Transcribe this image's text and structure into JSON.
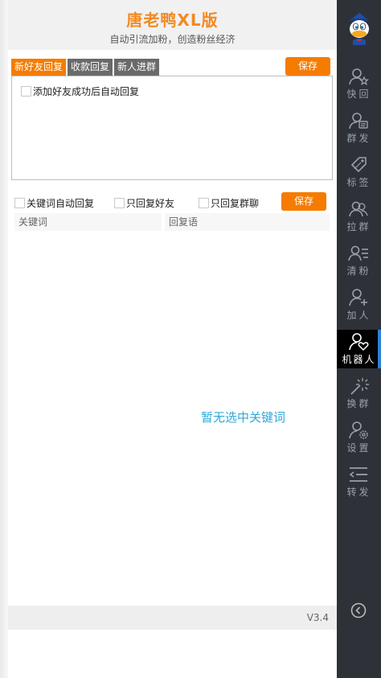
{
  "header": {
    "title": "唐老鸭XL版",
    "subtitle": "自动引流加粉，创造粉丝经济"
  },
  "tabs": [
    {
      "label": "新好友回复",
      "active": true
    },
    {
      "label": "收款回复",
      "active": false
    },
    {
      "label": "新人进群",
      "active": false
    }
  ],
  "save_top_label": "保存",
  "reply_box": {
    "checkbox_label": "添加好友成功后自动回复",
    "checked": false
  },
  "options": {
    "keyword_auto_reply": "关键词自动回复",
    "reply_friends_only": "只回复好友",
    "reply_groups_only": "只回复群聊",
    "save_label": "保存"
  },
  "table": {
    "columns": [
      "关键词",
      "回复语"
    ],
    "empty_message": "暂无选中关键词"
  },
  "footer": {
    "version": "V3.4"
  },
  "sidebar": {
    "items": [
      {
        "label": "快回",
        "icon": "user-star-icon",
        "active": false
      },
      {
        "label": "群发",
        "icon": "user-message-icon",
        "active": false
      },
      {
        "label": "标签",
        "icon": "tag-icon",
        "active": false
      },
      {
        "label": "拉群",
        "icon": "group-icon",
        "active": false
      },
      {
        "label": "清粉",
        "icon": "user-list-icon",
        "active": false
      },
      {
        "label": "加人",
        "icon": "user-add-icon",
        "active": false
      },
      {
        "label": "机器人",
        "icon": "user-heart-icon",
        "active": true
      },
      {
        "label": "换群",
        "icon": "magic-wand-icon",
        "active": false
      },
      {
        "label": "设置",
        "icon": "user-gear-icon",
        "active": false
      },
      {
        "label": "转发",
        "icon": "forward-list-icon",
        "active": false
      }
    ]
  },
  "colors": {
    "accent_orange": "#f57c00",
    "title_orange": "#f08a24",
    "sidebar_bg": "#2e3238",
    "active_indicator": "#2f80d8",
    "empty_message": "#2fa8d8"
  }
}
